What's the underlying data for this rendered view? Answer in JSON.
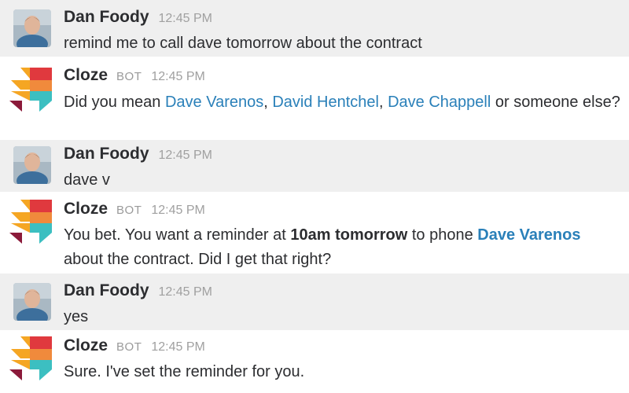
{
  "messages": [
    {
      "sender": "Dan Foody",
      "time": "12:45 PM",
      "text": "remind me to call dave tomorrow about the contract"
    },
    {
      "sender": "Cloze",
      "tag": "BOT",
      "time": "12:45 PM",
      "parts": [
        "Did you mean ",
        "Dave Varenos",
        ", ",
        "David Hentchel",
        ", ",
        "Dave Chappell",
        " or someone else?"
      ]
    },
    {
      "sender": "Dan Foody",
      "time": "12:45 PM",
      "text": "dave v"
    },
    {
      "sender": "Cloze",
      "tag": "BOT",
      "time": "12:45 PM",
      "parts": [
        "You bet. You want a reminder at ",
        "10am tomorrow",
        " to phone ",
        "Dave Varenos",
        " about the contract. Did I get that right?"
      ]
    },
    {
      "sender": "Dan Foody",
      "time": "12:45 PM",
      "text": "yes"
    },
    {
      "sender": "Cloze",
      "tag": "BOT",
      "time": "12:45 PM",
      "text": "Sure. I've set the reminder for you."
    }
  ],
  "colors": {
    "user_row_bg": "#efefef",
    "link": "#2a80b9",
    "logo_red": "#e0393e",
    "logo_orange": "#f5a623",
    "logo_teal": "#3cbfc1",
    "logo_maroon": "#8b1a3a"
  },
  "icons": {
    "user_avatar": "profile-photo",
    "bot_avatar": "cloze-logo"
  }
}
